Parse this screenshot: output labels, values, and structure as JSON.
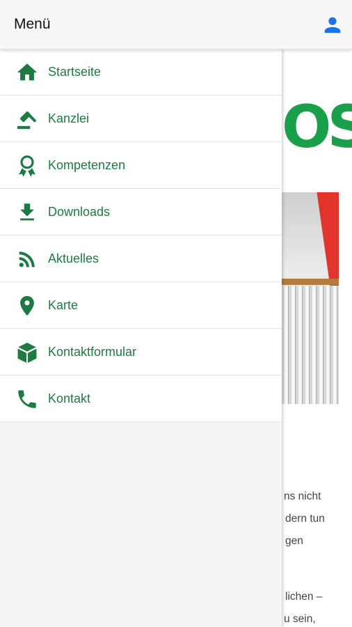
{
  "app_bar": {
    "title": "Menü",
    "user_icon": "user-icon"
  },
  "drawer": {
    "items": [
      {
        "label": "Startseite",
        "icon": "home-icon"
      },
      {
        "label": "Kanzlei",
        "icon": "gavel-icon"
      },
      {
        "label": "Kompetenzen",
        "icon": "award-icon"
      },
      {
        "label": "Downloads",
        "icon": "download-icon"
      },
      {
        "label": "Aktuelles",
        "icon": "rss-icon"
      },
      {
        "label": "Karte",
        "icon": "map-marker-icon"
      },
      {
        "label": "Kontaktformular",
        "icon": "box-icon"
      },
      {
        "label": "Kontakt",
        "icon": "phone-icon"
      }
    ]
  },
  "background_page": {
    "logo_fragment": "OS",
    "text_lines": [
      "ns nicht",
      "dern tun",
      "gen",
      "lichen –",
      "u sein,"
    ]
  },
  "colors": {
    "accent_green": "#1e7a43",
    "icon_blue": "#1a73e8",
    "logo_green": "#1aa04a"
  }
}
